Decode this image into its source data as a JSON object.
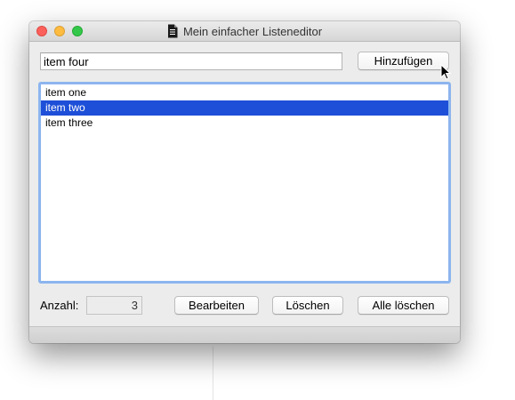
{
  "window": {
    "title": "Mein einfacher Listeneditor"
  },
  "input": {
    "value": "item four"
  },
  "buttons": {
    "add": "Hinzufügen",
    "edit": "Bearbeiten",
    "delete": "Löschen",
    "delete_all": "Alle löschen"
  },
  "list": {
    "items": [
      "item one",
      "item two",
      "item three"
    ],
    "selected_index": 1
  },
  "count": {
    "label": "Anzahl:",
    "value": "3"
  },
  "colors": {
    "selection": "#1e4fd8",
    "focus_ring": "#8cb5ee"
  },
  "icons": {
    "title": "document-icon",
    "pointer": "mouse-cursor-icon"
  }
}
